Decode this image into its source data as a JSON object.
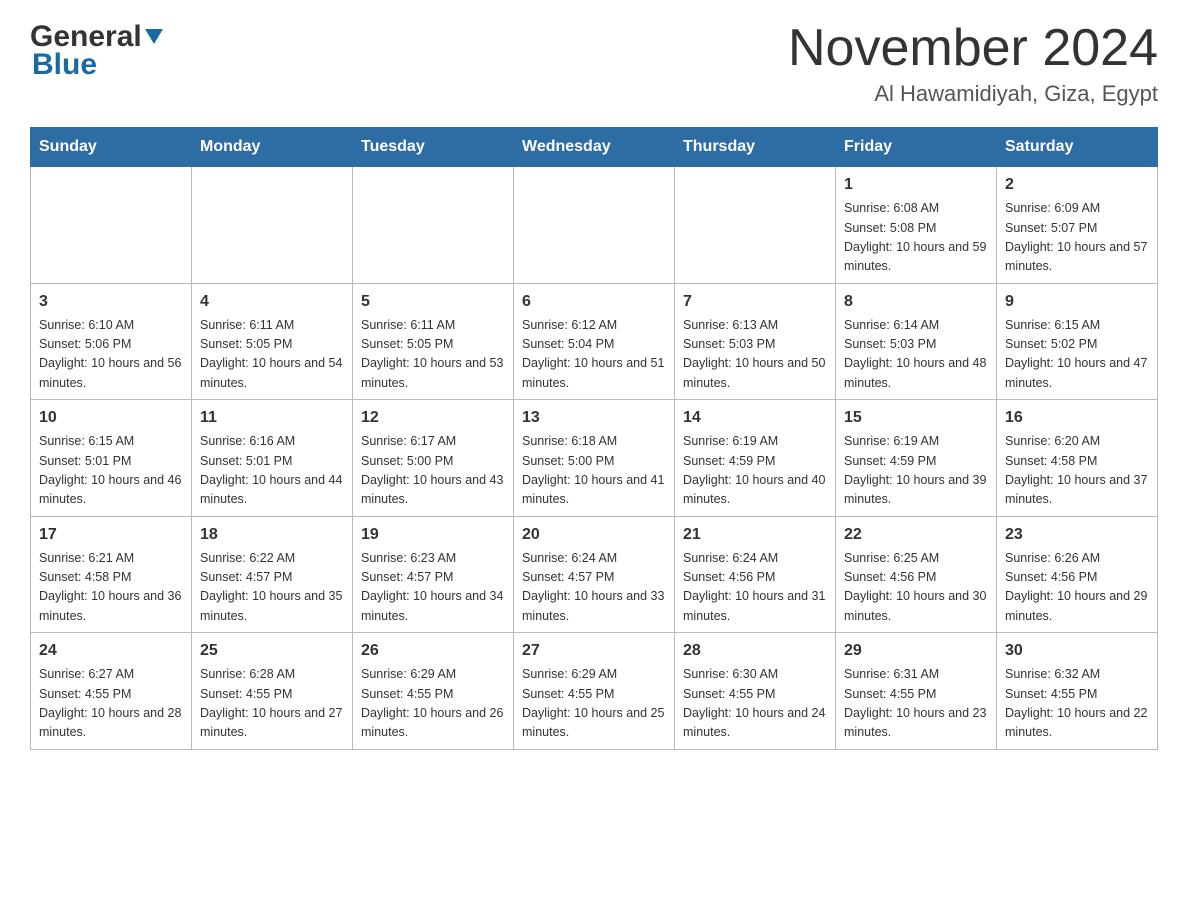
{
  "header": {
    "logo_general": "General",
    "logo_blue": "Blue",
    "month_title": "November 2024",
    "location": "Al Hawamidiyah, Giza, Egypt"
  },
  "weekdays": [
    "Sunday",
    "Monday",
    "Tuesday",
    "Wednesday",
    "Thursday",
    "Friday",
    "Saturday"
  ],
  "rows": [
    [
      {
        "day": "",
        "sunrise": "",
        "sunset": "",
        "daylight": ""
      },
      {
        "day": "",
        "sunrise": "",
        "sunset": "",
        "daylight": ""
      },
      {
        "day": "",
        "sunrise": "",
        "sunset": "",
        "daylight": ""
      },
      {
        "day": "",
        "sunrise": "",
        "sunset": "",
        "daylight": ""
      },
      {
        "day": "",
        "sunrise": "",
        "sunset": "",
        "daylight": ""
      },
      {
        "day": "1",
        "sunrise": "Sunrise: 6:08 AM",
        "sunset": "Sunset: 5:08 PM",
        "daylight": "Daylight: 10 hours and 59 minutes."
      },
      {
        "day": "2",
        "sunrise": "Sunrise: 6:09 AM",
        "sunset": "Sunset: 5:07 PM",
        "daylight": "Daylight: 10 hours and 57 minutes."
      }
    ],
    [
      {
        "day": "3",
        "sunrise": "Sunrise: 6:10 AM",
        "sunset": "Sunset: 5:06 PM",
        "daylight": "Daylight: 10 hours and 56 minutes."
      },
      {
        "day": "4",
        "sunrise": "Sunrise: 6:11 AM",
        "sunset": "Sunset: 5:05 PM",
        "daylight": "Daylight: 10 hours and 54 minutes."
      },
      {
        "day": "5",
        "sunrise": "Sunrise: 6:11 AM",
        "sunset": "Sunset: 5:05 PM",
        "daylight": "Daylight: 10 hours and 53 minutes."
      },
      {
        "day": "6",
        "sunrise": "Sunrise: 6:12 AM",
        "sunset": "Sunset: 5:04 PM",
        "daylight": "Daylight: 10 hours and 51 minutes."
      },
      {
        "day": "7",
        "sunrise": "Sunrise: 6:13 AM",
        "sunset": "Sunset: 5:03 PM",
        "daylight": "Daylight: 10 hours and 50 minutes."
      },
      {
        "day": "8",
        "sunrise": "Sunrise: 6:14 AM",
        "sunset": "Sunset: 5:03 PM",
        "daylight": "Daylight: 10 hours and 48 minutes."
      },
      {
        "day": "9",
        "sunrise": "Sunrise: 6:15 AM",
        "sunset": "Sunset: 5:02 PM",
        "daylight": "Daylight: 10 hours and 47 minutes."
      }
    ],
    [
      {
        "day": "10",
        "sunrise": "Sunrise: 6:15 AM",
        "sunset": "Sunset: 5:01 PM",
        "daylight": "Daylight: 10 hours and 46 minutes."
      },
      {
        "day": "11",
        "sunrise": "Sunrise: 6:16 AM",
        "sunset": "Sunset: 5:01 PM",
        "daylight": "Daylight: 10 hours and 44 minutes."
      },
      {
        "day": "12",
        "sunrise": "Sunrise: 6:17 AM",
        "sunset": "Sunset: 5:00 PM",
        "daylight": "Daylight: 10 hours and 43 minutes."
      },
      {
        "day": "13",
        "sunrise": "Sunrise: 6:18 AM",
        "sunset": "Sunset: 5:00 PM",
        "daylight": "Daylight: 10 hours and 41 minutes."
      },
      {
        "day": "14",
        "sunrise": "Sunrise: 6:19 AM",
        "sunset": "Sunset: 4:59 PM",
        "daylight": "Daylight: 10 hours and 40 minutes."
      },
      {
        "day": "15",
        "sunrise": "Sunrise: 6:19 AM",
        "sunset": "Sunset: 4:59 PM",
        "daylight": "Daylight: 10 hours and 39 minutes."
      },
      {
        "day": "16",
        "sunrise": "Sunrise: 6:20 AM",
        "sunset": "Sunset: 4:58 PM",
        "daylight": "Daylight: 10 hours and 37 minutes."
      }
    ],
    [
      {
        "day": "17",
        "sunrise": "Sunrise: 6:21 AM",
        "sunset": "Sunset: 4:58 PM",
        "daylight": "Daylight: 10 hours and 36 minutes."
      },
      {
        "day": "18",
        "sunrise": "Sunrise: 6:22 AM",
        "sunset": "Sunset: 4:57 PM",
        "daylight": "Daylight: 10 hours and 35 minutes."
      },
      {
        "day": "19",
        "sunrise": "Sunrise: 6:23 AM",
        "sunset": "Sunset: 4:57 PM",
        "daylight": "Daylight: 10 hours and 34 minutes."
      },
      {
        "day": "20",
        "sunrise": "Sunrise: 6:24 AM",
        "sunset": "Sunset: 4:57 PM",
        "daylight": "Daylight: 10 hours and 33 minutes."
      },
      {
        "day": "21",
        "sunrise": "Sunrise: 6:24 AM",
        "sunset": "Sunset: 4:56 PM",
        "daylight": "Daylight: 10 hours and 31 minutes."
      },
      {
        "day": "22",
        "sunrise": "Sunrise: 6:25 AM",
        "sunset": "Sunset: 4:56 PM",
        "daylight": "Daylight: 10 hours and 30 minutes."
      },
      {
        "day": "23",
        "sunrise": "Sunrise: 6:26 AM",
        "sunset": "Sunset: 4:56 PM",
        "daylight": "Daylight: 10 hours and 29 minutes."
      }
    ],
    [
      {
        "day": "24",
        "sunrise": "Sunrise: 6:27 AM",
        "sunset": "Sunset: 4:55 PM",
        "daylight": "Daylight: 10 hours and 28 minutes."
      },
      {
        "day": "25",
        "sunrise": "Sunrise: 6:28 AM",
        "sunset": "Sunset: 4:55 PM",
        "daylight": "Daylight: 10 hours and 27 minutes."
      },
      {
        "day": "26",
        "sunrise": "Sunrise: 6:29 AM",
        "sunset": "Sunset: 4:55 PM",
        "daylight": "Daylight: 10 hours and 26 minutes."
      },
      {
        "day": "27",
        "sunrise": "Sunrise: 6:29 AM",
        "sunset": "Sunset: 4:55 PM",
        "daylight": "Daylight: 10 hours and 25 minutes."
      },
      {
        "day": "28",
        "sunrise": "Sunrise: 6:30 AM",
        "sunset": "Sunset: 4:55 PM",
        "daylight": "Daylight: 10 hours and 24 minutes."
      },
      {
        "day": "29",
        "sunrise": "Sunrise: 6:31 AM",
        "sunset": "Sunset: 4:55 PM",
        "daylight": "Daylight: 10 hours and 23 minutes."
      },
      {
        "day": "30",
        "sunrise": "Sunrise: 6:32 AM",
        "sunset": "Sunset: 4:55 PM",
        "daylight": "Daylight: 10 hours and 22 minutes."
      }
    ]
  ]
}
